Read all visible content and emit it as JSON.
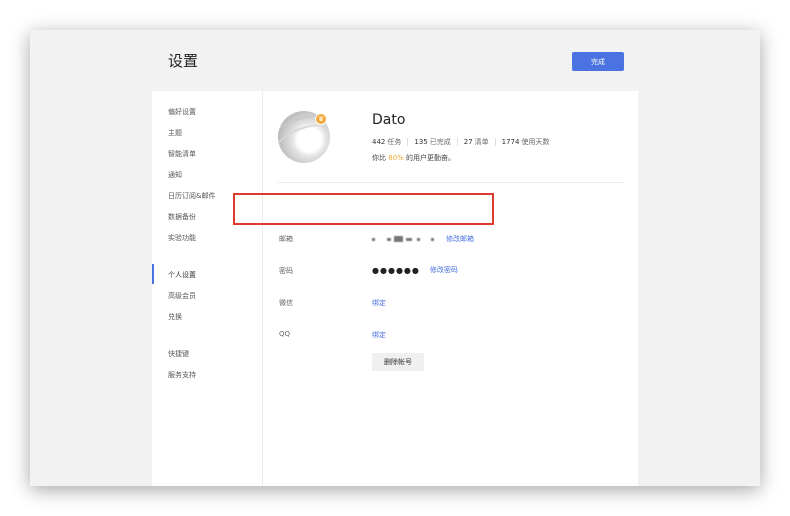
{
  "header": {
    "title": "设置",
    "done_label": "完成"
  },
  "sidebar": {
    "items": [
      {
        "label": "偏好设置"
      },
      {
        "label": "主题"
      },
      {
        "label": "智能清单"
      },
      {
        "label": "通知"
      },
      {
        "label": "日历订阅&邮件"
      },
      {
        "label": "数据备份"
      },
      {
        "label": "实验功能"
      },
      {
        "label": "个人设置",
        "active": true
      },
      {
        "label": "高级会员"
      },
      {
        "label": "兑换"
      },
      {
        "label": "快捷键"
      },
      {
        "label": "服务支持"
      }
    ]
  },
  "profile": {
    "username": "Dato",
    "stats": [
      {
        "num": "442",
        "label": "任务"
      },
      {
        "num": "135",
        "label": "已完成"
      },
      {
        "num": "27",
        "label": "清单"
      },
      {
        "num": "1774",
        "label": "使用天数"
      }
    ],
    "diligence_prefix": "你比",
    "diligence_pct": "80%",
    "diligence_suffix": "的用户更勤奋。",
    "badge_icon": "crown-icon"
  },
  "account": {
    "email": {
      "label": "邮箱",
      "action": "修改邮箱"
    },
    "password": {
      "label": "密码",
      "masked": "●●●●●●",
      "action": "修改密码"
    },
    "wechat": {
      "label": "微信",
      "action": "绑定"
    },
    "qq": {
      "label": "QQ",
      "action": "绑定"
    },
    "delete_label": "删除帐号"
  },
  "colors": {
    "accent": "#4a72e0",
    "highlight": "#e0392e",
    "gold": "#f0a83a"
  }
}
